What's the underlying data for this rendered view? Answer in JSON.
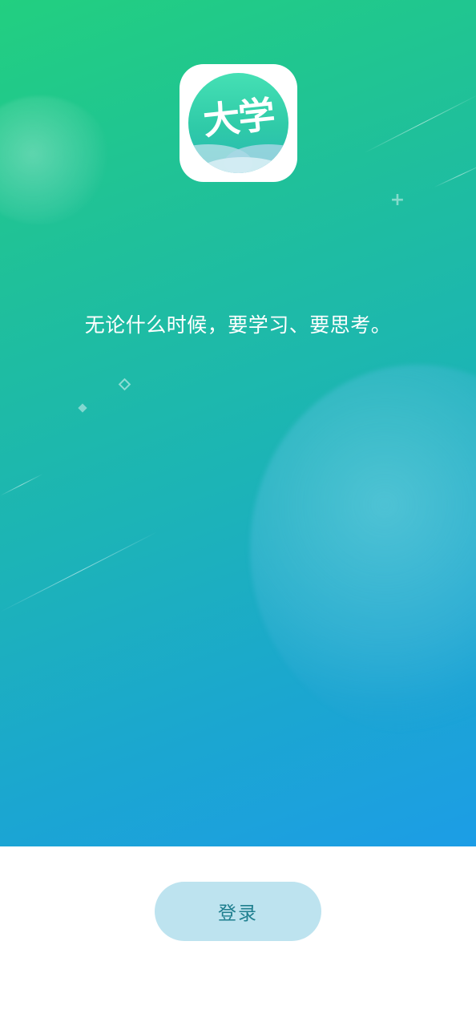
{
  "app": {
    "icon_text": "大学",
    "icon_name": "university-app-icon"
  },
  "splash": {
    "tagline": "无论什么时候，要学习、要思考。"
  },
  "actions": {
    "login_label": "登录"
  },
  "colors": {
    "gradient_start": "#22cf80",
    "gradient_end": "#1c9de6",
    "button_bg": "#bde3ef",
    "button_text": "#1f7f8f",
    "page_bg": "#ffffff"
  },
  "icons": [
    "plus-icon",
    "diamond-outline-icon",
    "diamond-solid-icon"
  ]
}
